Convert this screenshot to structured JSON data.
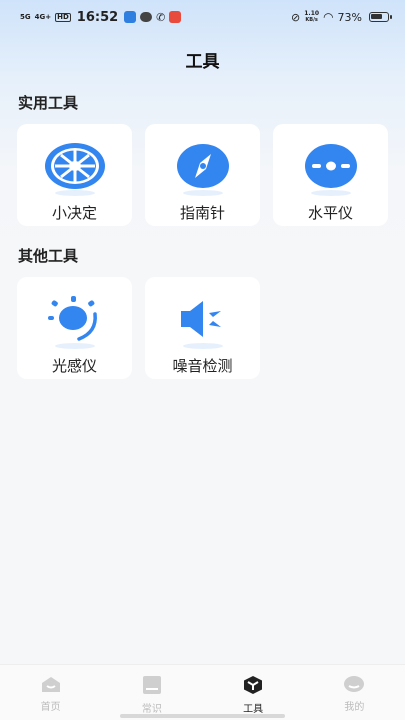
{
  "status_bar": {
    "sim1": "5G",
    "sim2": "4G+",
    "hd": "HD",
    "time": "16:52",
    "net_speed_top": "1.10",
    "net_speed_bottom": "KB/s",
    "battery": "73%"
  },
  "header": {
    "title": "工具"
  },
  "sections": [
    {
      "title": "实用工具",
      "items": [
        {
          "label": "小决定",
          "icon": "wheel-icon"
        },
        {
          "label": "指南针",
          "icon": "compass-icon"
        },
        {
          "label": "水平仪",
          "icon": "level-icon"
        }
      ]
    },
    {
      "title": "其他工具",
      "items": [
        {
          "label": "光感仪",
          "icon": "light-sensor-icon"
        },
        {
          "label": "噪音检测",
          "icon": "noise-meter-icon"
        }
      ]
    }
  ],
  "tabbar": {
    "tabs": [
      {
        "label": "首页",
        "icon": "home-icon",
        "active": false
      },
      {
        "label": "常识",
        "icon": "book-icon",
        "active": false
      },
      {
        "label": "工具",
        "icon": "cube-icon",
        "active": true
      },
      {
        "label": "我的",
        "icon": "profile-icon",
        "active": false
      }
    ]
  },
  "colors": {
    "accent": "#3385F0",
    "text": "#222222",
    "inactive": "#BBBBBB"
  }
}
